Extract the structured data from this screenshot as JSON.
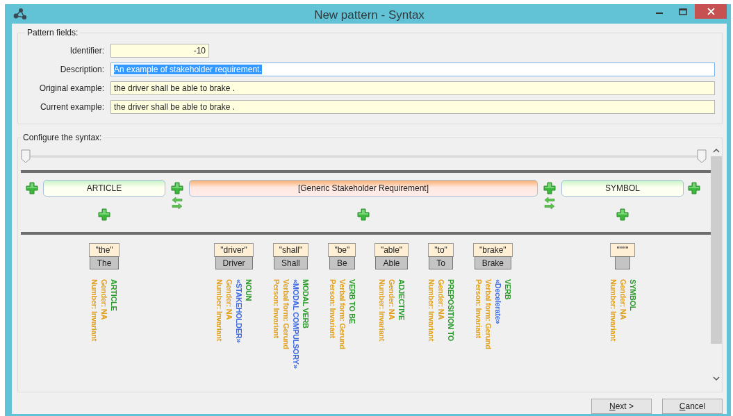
{
  "window": {
    "title": "New pattern - Syntax"
  },
  "pattern_fields": {
    "legend": "Pattern fields:",
    "fields": [
      {
        "label": "Identifier:",
        "value": "-10",
        "kind": "short",
        "selected": false
      },
      {
        "label": "Description:",
        "value": "An example of stakeholder requirement.",
        "kind": "long",
        "selected": true
      },
      {
        "label": "Original example:",
        "value": "the driver shall be able to brake .",
        "kind": "long",
        "selected": false
      },
      {
        "label": "Current example:",
        "value": "the driver shall be able to brake .",
        "kind": "long",
        "selected": false
      }
    ]
  },
  "syntax": {
    "legend": "Configure the syntax:",
    "slider": {
      "thumbs": [
        {
          "level": 0
        },
        {
          "level": 1
        }
      ]
    },
    "elements": [
      {
        "label": "ARTICLE",
        "kind": "category",
        "tokens": [
          {
            "word": "\"the\"",
            "lemma": "The",
            "lines": [
              {
                "text": "ARTICLE",
                "kind": "category"
              },
              {
                "text": "Gender: NA",
                "kind": "feature"
              },
              {
                "text": "Number: Invariant",
                "kind": "feature"
              }
            ]
          }
        ]
      },
      {
        "label": "[Generic Stakeholder Requirement]",
        "kind": "group",
        "tokens": [
          {
            "word": "\"driver\"",
            "lemma": "Driver",
            "lines": [
              {
                "text": "NOUN",
                "kind": "category"
              },
              {
                "text": "«STAKEHOLDER»",
                "kind": "semantic"
              },
              {
                "text": "Gender: NA",
                "kind": "feature"
              },
              {
                "text": "Number: Invariant",
                "kind": "feature"
              }
            ]
          },
          {
            "word": "\"shall\"",
            "lemma": "Shall",
            "lines": [
              {
                "text": "MODAL VERB",
                "kind": "category"
              },
              {
                "text": "«MODAL COMPULSORY»",
                "kind": "semantic"
              },
              {
                "text": "Verbal form: Gerund",
                "kind": "feature"
              },
              {
                "text": "Person: Invariant",
                "kind": "feature"
              }
            ]
          },
          {
            "word": "\"be\"",
            "lemma": "Be",
            "lines": [
              {
                "text": "VERB TO BE",
                "kind": "category"
              },
              {
                "text": "Verbal form: Gerund",
                "kind": "feature"
              },
              {
                "text": "Person: Invariant",
                "kind": "feature"
              }
            ]
          },
          {
            "word": "\"able\"",
            "lemma": "Able",
            "lines": [
              {
                "text": "ADJECTIVE",
                "kind": "category"
              },
              {
                "text": "Gender: NA",
                "kind": "feature"
              },
              {
                "text": "Number: Invariant",
                "kind": "feature"
              }
            ]
          },
          {
            "word": "\"to\"",
            "lemma": "To",
            "lines": [
              {
                "text": "PREPOSITION TO",
                "kind": "category"
              },
              {
                "text": "Gender: NA",
                "kind": "feature"
              },
              {
                "text": "Number: Invariant",
                "kind": "feature"
              }
            ]
          },
          {
            "word": "\"brake\"",
            "lemma": "Brake",
            "lines": [
              {
                "text": "VERB",
                "kind": "category"
              },
              {
                "text": "«Decelerate»",
                "kind": "semantic"
              },
              {
                "text": "Verbal form: Gerund",
                "kind": "feature"
              },
              {
                "text": "Person: Invariant",
                "kind": "feature"
              }
            ]
          }
        ]
      },
      {
        "label": "SYMBOL",
        "kind": "category",
        "tokens": [
          {
            "word": "\"\"\"\"",
            "lines": [
              {
                "text": "SYMBOL",
                "kind": "category"
              },
              {
                "text": "Gender: NA",
                "kind": "feature"
              },
              {
                "text": "Number: Invariant",
                "kind": "feature"
              }
            ]
          }
        ]
      }
    ]
  },
  "buttons": [
    "Next >",
    "Cancel"
  ]
}
